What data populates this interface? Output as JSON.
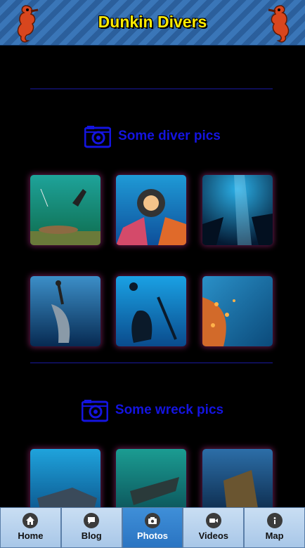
{
  "header": {
    "title": "Dunkin Divers"
  },
  "sections": [
    {
      "label": "Some diver pics"
    },
    {
      "label": "Some wreck pics"
    }
  ],
  "nav": [
    {
      "label": "Home",
      "icon": "home-icon"
    },
    {
      "label": "Blog",
      "icon": "chat-bubble-icon"
    },
    {
      "label": "Photos",
      "icon": "camera-icon",
      "active": true
    },
    {
      "label": "Videos",
      "icon": "video-camera-icon"
    },
    {
      "label": "Map",
      "icon": "info-icon"
    }
  ],
  "colors": {
    "accent": "#1414e0",
    "title": "#ffea00",
    "nav_active": "#2a74c2"
  }
}
